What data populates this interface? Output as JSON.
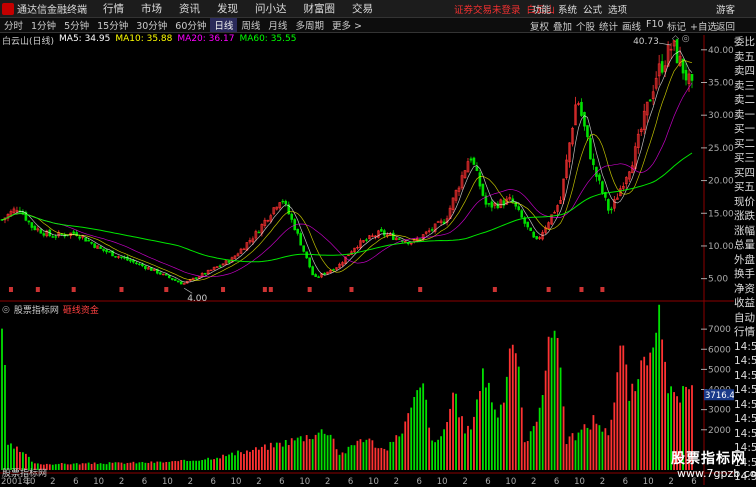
{
  "topbar": {
    "app_title": "通达信金融终端",
    "menus": [
      "行情",
      "市场",
      "资讯",
      "发现",
      "问小达",
      "财富圈",
      "交易"
    ],
    "login_text": "证券交易未登录",
    "stock_name": "白云山",
    "right_menus": [
      "功能",
      "系统",
      "公式",
      "选项",
      "游客"
    ]
  },
  "periodbar": {
    "periods": [
      "分时",
      "1分钟",
      "5分钟",
      "15分钟",
      "30分钟",
      "60分钟",
      "日线",
      "周线",
      "月线",
      "多周期",
      "更多 >"
    ],
    "active": "日线",
    "tools": [
      "复权",
      "叠加",
      "个股",
      "统计",
      "画线",
      "F10",
      "标记",
      "+自选",
      "返回"
    ]
  },
  "legend": {
    "stock": "白云山(日线)",
    "ma5": "MA5: 34.95",
    "ma10": "MA10: 35.88",
    "ma20": "MA20: 36.17",
    "ma60": "MA60: 35.55",
    "icons": "◇ ◎"
  },
  "colors": {
    "up": "#ff3232",
    "down": "#00e000",
    "ma5": "#ffffff",
    "ma10": "#ffff00",
    "ma20": "#ff00ff",
    "ma60": "#00ff00",
    "grid": "#8b0000",
    "axis": "#aaaaaa"
  },
  "price_axis": [
    "40.00",
    "35.00",
    "30.00",
    "25.00",
    "20.00",
    "15.00",
    "10.00",
    "5.00"
  ],
  "price_annotations": {
    "high": "40.73",
    "low": "4.00"
  },
  "right_panel": [
    "委比",
    "卖五",
    "卖四",
    "卖三",
    "卖二",
    "卖一",
    "买一",
    "买二",
    "买三",
    "买四",
    "买五",
    "现价",
    "涨跌",
    "涨幅",
    "总量",
    "外盘",
    "换手",
    "净资",
    "收益",
    "自动",
    "行情",
    "14:50",
    "14:50",
    "14:50",
    "14:50",
    "14:50",
    "14:50",
    "14:50",
    "14:50",
    "14:50",
    "14:50",
    "14:50"
  ],
  "indicator": {
    "icon": "◎",
    "source": "股票指标网",
    "name": "砸线资金",
    "axis": [
      "7000",
      "6000",
      "5000",
      "4000",
      "3000",
      "2000"
    ],
    "current_value": "3716.47"
  },
  "x_axis": {
    "start": "2001年",
    "ticks": [
      "10",
      "2",
      "6",
      "10",
      "2",
      "6",
      "10",
      "2",
      "6",
      "10",
      "2",
      "6",
      "10",
      "2",
      "6",
      "10",
      "2",
      "6",
      "10",
      "2",
      "6",
      "10",
      "2",
      "6",
      "10",
      "2",
      "6",
      "10",
      "2",
      "6"
    ]
  },
  "watermark": {
    "line1": "股票指标网",
    "line2": "www.7gpzb.com"
  },
  "bottom_left_label": "股票指标网"
}
